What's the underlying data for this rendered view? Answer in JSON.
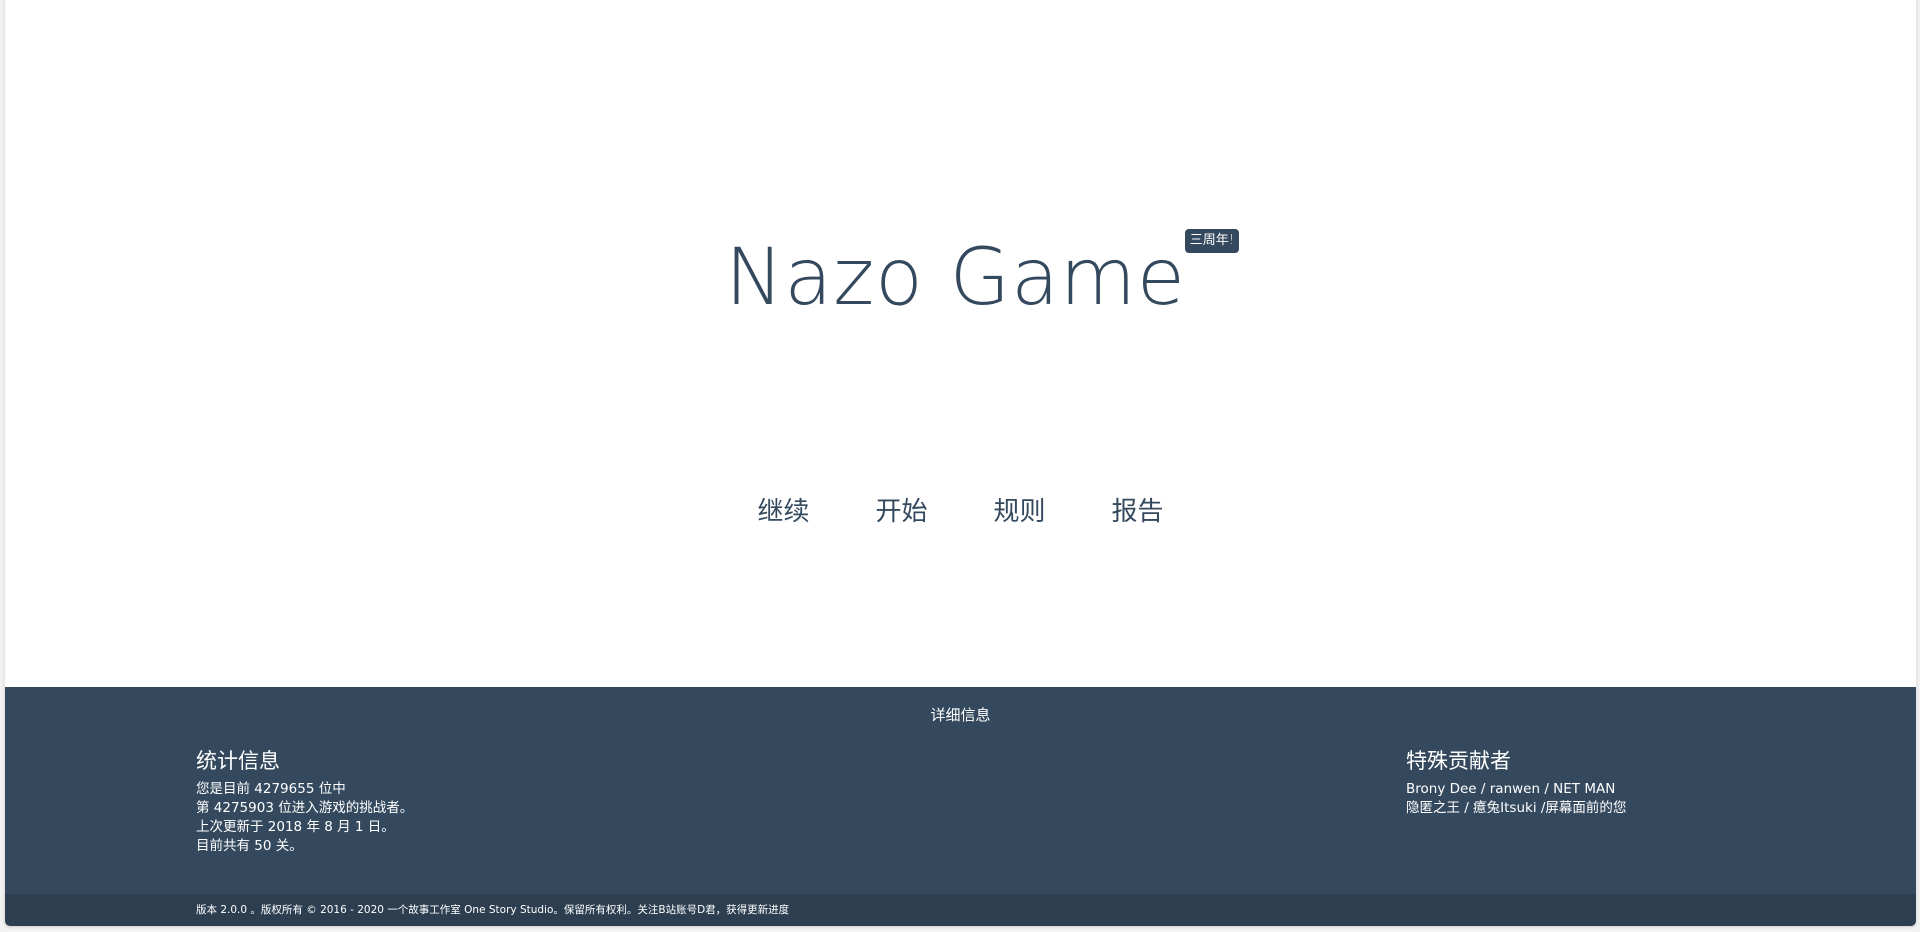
{
  "header": {
    "title": "Nazo Game",
    "badge": "三周年!"
  },
  "nav": {
    "items": [
      {
        "label": "继续"
      },
      {
        "label": "开始"
      },
      {
        "label": "规则"
      },
      {
        "label": "报告"
      }
    ]
  },
  "footer": {
    "details_label": "详细信息",
    "stats": {
      "title": "统计信息",
      "lines": [
        "您是目前 4279655 位中",
        "第 4275903 位进入游戏的挑战者。",
        "上次更新于 2018 年 8 月 1 日。",
        "目前共有 50 关。"
      ]
    },
    "contributors": {
      "title": "特殊贡献者",
      "lines": [
        "Brony Dee / ranwen / NET MAN",
        "隐匿之王 / 癔兔Itsuki /屏幕面前的您"
      ]
    },
    "copyright": "版本 2.0.0 。版权所有 © 2016 - 2020 一个故事工作室 One Story Studio。保留所有权利。关注B站账号D君，获得更新进度"
  },
  "colors": {
    "primary": "#34495e",
    "bottom_bar": "#2c3e50",
    "background": "#ffffff"
  }
}
